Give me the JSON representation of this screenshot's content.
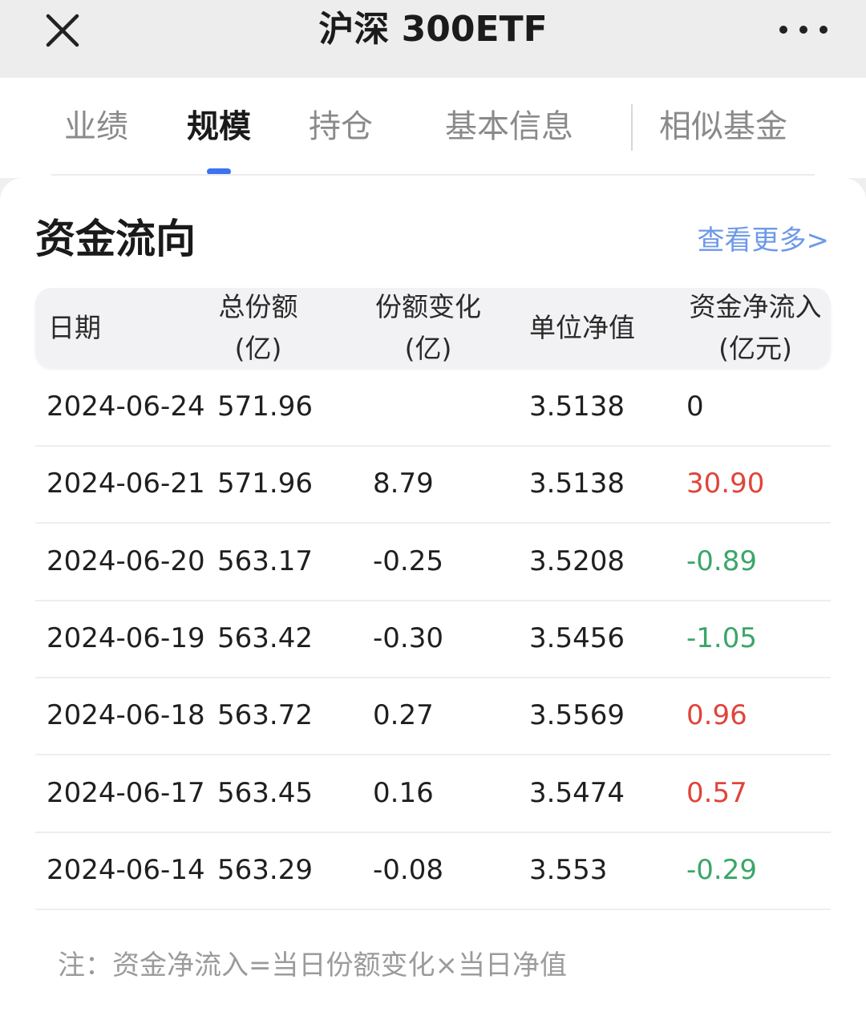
{
  "navbar": {
    "title": "沪深 300ETF",
    "close_icon": "close-icon",
    "more_icon": "more-dots-icon"
  },
  "tabs": [
    {
      "label": "业绩",
      "active": false
    },
    {
      "label": "规模",
      "active": true
    },
    {
      "label": "持仓",
      "active": false
    },
    {
      "label": "基本信息",
      "active": false
    },
    {
      "label": "相似基金",
      "active": false
    }
  ],
  "section": {
    "title": "资金流向",
    "see_more": "查看更多>"
  },
  "table": {
    "headers": [
      {
        "line1": "日期",
        "line2": ""
      },
      {
        "line1": "总份额",
        "line2": "(亿)"
      },
      {
        "line1": "份额变化",
        "line2": "(亿)"
      },
      {
        "line1": "单位净值",
        "line2": ""
      },
      {
        "line1": "资金净流入",
        "line2": "(亿元)"
      }
    ],
    "rows": [
      {
        "date": "2024-06-24",
        "total": "571.96",
        "change": "",
        "nav": "3.5138",
        "net_flow": "0",
        "trend": "neutral"
      },
      {
        "date": "2024-06-21",
        "total": "571.96",
        "change": "8.79",
        "nav": "3.5138",
        "net_flow": "30.90",
        "trend": "pos"
      },
      {
        "date": "2024-06-20",
        "total": "563.17",
        "change": "-0.25",
        "nav": "3.5208",
        "net_flow": "-0.89",
        "trend": "neg"
      },
      {
        "date": "2024-06-19",
        "total": "563.42",
        "change": "-0.30",
        "nav": "3.5456",
        "net_flow": "-1.05",
        "trend": "neg"
      },
      {
        "date": "2024-06-18",
        "total": "563.72",
        "change": "0.27",
        "nav": "3.5569",
        "net_flow": "0.96",
        "trend": "pos"
      },
      {
        "date": "2024-06-17",
        "total": "563.45",
        "change": "0.16",
        "nav": "3.5474",
        "net_flow": "0.57",
        "trend": "pos"
      },
      {
        "date": "2024-06-14",
        "total": "563.29",
        "change": "-0.08",
        "nav": "3.553",
        "net_flow": "-0.29",
        "trend": "neg"
      }
    ]
  },
  "footnote": "注：资金净流入=当日份额变化×当日净值",
  "colors": {
    "accent": "#3b73f0",
    "link": "#6d99e8",
    "positive": "#e0443a",
    "negative": "#3aa669"
  }
}
